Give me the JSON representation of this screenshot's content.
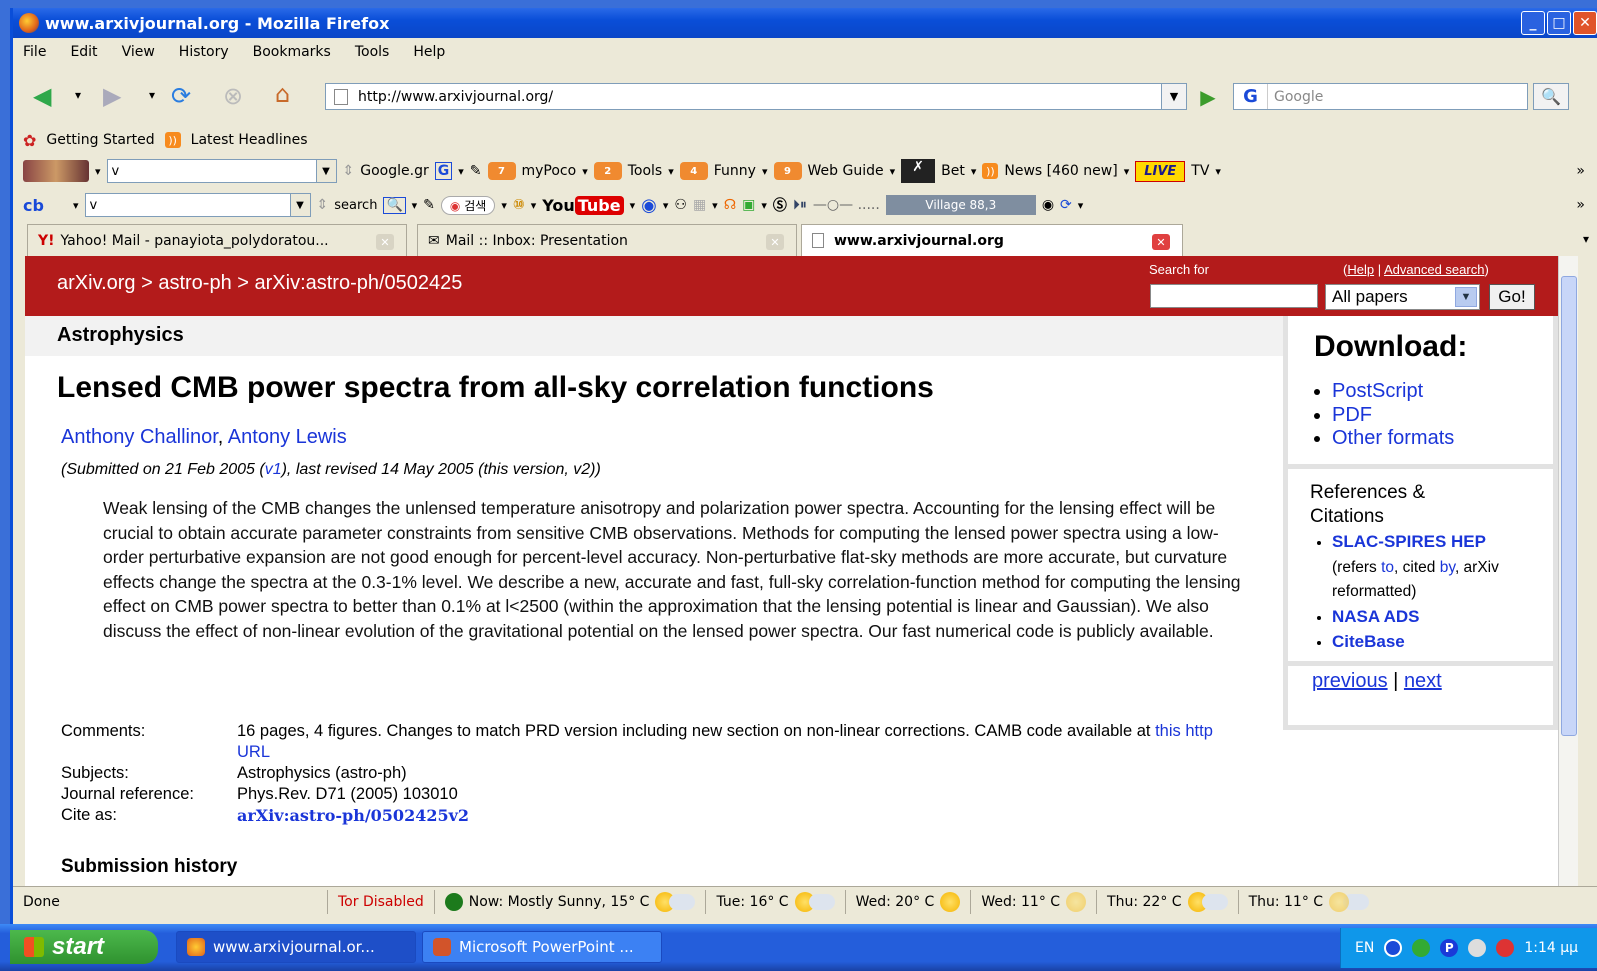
{
  "window": {
    "title": "www.arxivjournal.org - Mozilla Firefox"
  },
  "menu": [
    "File",
    "Edit",
    "View",
    "History",
    "Bookmarks",
    "Tools",
    "Help"
  ],
  "nav": {
    "url": "http://www.arxivjournal.org/",
    "search_placeholder": "Google"
  },
  "bookmarks": [
    "Getting Started",
    "Latest Headlines"
  ],
  "toolbar1": {
    "input": "v",
    "items": [
      "Google.gr",
      "myPoco",
      "Tools",
      "Funny",
      "Web Guide",
      "Bet",
      "News [460 new]",
      "LIVE",
      "TV"
    ]
  },
  "toolbar2": {
    "input": "v",
    "search_label": "search",
    "kr_label": "검색",
    "youtube_a": "You",
    "youtube_b": "Tube",
    "radio": "Village 88,3"
  },
  "tabs": [
    {
      "label": "Yahoo! Mail - panayiota_polydoratou..."
    },
    {
      "label": "Mail :: Inbox: Presentation"
    },
    {
      "label": "www.arxivjournal.org"
    }
  ],
  "arxiv": {
    "breadcrumb": "arXiv.org > astro-ph > arXiv:astro-ph/0502425",
    "search_for": "Search for",
    "help": "Help",
    "advanced": "Advanced search",
    "select": "All papers",
    "go": "Go!",
    "subject_header": "Astrophysics",
    "title": "Lensed CMB power spectra from all-sky correlation functions",
    "author1": "Anthony Challinor",
    "author2": "Antony Lewis",
    "submitted_a": "(Submitted on 21 Feb 2005 (",
    "submitted_v1": "v1",
    "submitted_b": "), last revised 14 May 2005 (this version, v2))",
    "abstract": "Weak lensing of the CMB changes the unlensed temperature anisotropy and polarization power spectra. Accounting for the lensing effect will be crucial to obtain accurate parameter constraints from sensitive CMB observations. Methods for computing the lensed power spectra using a low-order perturbative expansion are not good enough for percent-level accuracy. Non-perturbative flat-sky methods are more accurate, but curvature effects change the spectra at the 0.3-1% level. We describe a new, accurate and fast, full-sky correlation-function method for computing the lensing effect on CMB power spectra to better than 0.1% at l<2500 (within the approximation that the lensing potential is linear and Gaussian). We also discuss the effect of non-linear evolution of the gravitational potential on the lensed power spectra. Our fast numerical code is publicly available.",
    "comments_label": "Comments:",
    "comments": "16 pages, 4 figures. Changes to match PRD version including new section on non-linear corrections. CAMB code available at ",
    "comments_link": "this http URL",
    "subjects_label": "Subjects:",
    "subjects": "Astrophysics (astro-ph)",
    "journal_label": "Journal reference:",
    "journal": "Phys.Rev. D71 (2005) 103010",
    "cite_label": "Cite as:",
    "cite": "arXiv:astro-ph/0502425v2",
    "history": "Submission history",
    "download_title": "Download:",
    "downloads": [
      "PostScript",
      "PDF",
      "Other formats"
    ],
    "refs_title": "References & Citations",
    "slac": "SLAC-SPIRES HEP",
    "refers_a": "(refers ",
    "refers_to": "to",
    "refers_b": ", cited ",
    "refers_by": "by",
    "refers_c": ", arXiv reformatted)",
    "nasa": "NASA ADS",
    "citebase": "CiteBase",
    "previous": "previous",
    "next": "next"
  },
  "status": {
    "done": "Done",
    "tor": "Tor Disabled",
    "now": "Now: Mostly Sunny, 15° C",
    "tue": "Tue: 16° C",
    "wed1": "Wed: 20° C",
    "wed2": "Wed: 11° C",
    "thu1": "Thu: 22° C",
    "thu2": "Thu: 11° C"
  },
  "taskbar": {
    "start": "start",
    "task1": "www.arxivjournal.or...",
    "task2": "Microsoft PowerPoint ...",
    "lang": "EN",
    "time": "1:14 μμ"
  },
  "colors": {
    "arxiv_red": "#b31b1b",
    "link_blue": "#1a35d8",
    "xp_blue": "#245edb"
  }
}
